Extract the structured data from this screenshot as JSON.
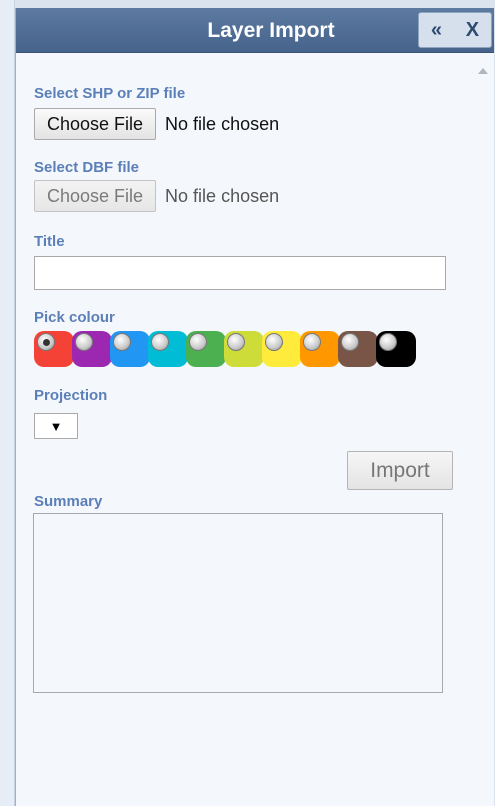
{
  "header": {
    "title": "Layer Import",
    "collapse_icon": "double-chevron-left-icon",
    "collapse_glyph": "«",
    "close_icon": "close-icon",
    "close_glyph": "X"
  },
  "shp_file": {
    "label": "Select SHP or ZIP file",
    "button_label": "Choose File",
    "status": "No file chosen"
  },
  "dbf_file": {
    "label": "Select DBF file",
    "button_label": "Choose File",
    "status": "No file chosen",
    "disabled": true
  },
  "title_field": {
    "label": "Title",
    "value": ""
  },
  "colour_picker": {
    "label": "Pick colour",
    "selected_index": 0,
    "colours": [
      "#f44336",
      "#9c27b0",
      "#2196f3",
      "#00bcd4",
      "#4caf50",
      "#cddc39",
      "#ffeb3b",
      "#ff9800",
      "#795548",
      "#000000"
    ]
  },
  "projection": {
    "label": "Projection",
    "selected_value": "",
    "dropdown_glyph": "▼"
  },
  "import_button": {
    "label": "Import",
    "disabled": true
  },
  "summary": {
    "label": "Summary",
    "content": ""
  },
  "colors": {
    "header_bg": "#4f6d95",
    "label_text": "#5b7fb8",
    "panel_bg": "#f4f7fb"
  }
}
